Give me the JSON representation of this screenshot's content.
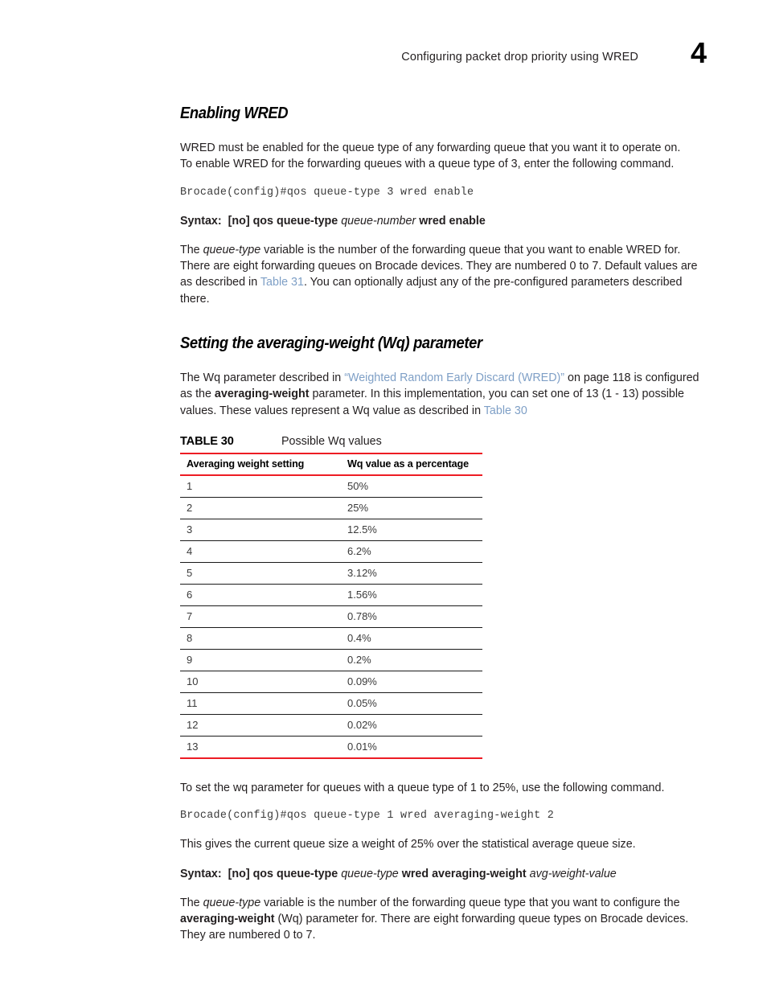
{
  "header": {
    "title": "Configuring packet drop priority using WRED",
    "chapter_number": "4"
  },
  "sections": [
    {
      "heading": "Enabling WRED",
      "paragraph_1_line_1": "WRED must be enabled for the queue type of any forwarding queue that you want it to operate on.",
      "paragraph_1_line_2": "To enable WRED for the forwarding queues with a queue type of 3, enter the following command.",
      "command": "Brocade(config)#qos queue-type 3 wred enable",
      "syntax": {
        "label": "Syntax:",
        "part_1": "[no] qos queue-type",
        "part_2": "queue-number",
        "part_3": "wred enable"
      },
      "paragraph_2": {
        "t1": "The ",
        "var1": "queue-type",
        "t2": " variable is the number of the forwarding queue that you want to enable WRED for. There are eight forwarding queues on Brocade devices. They are numbered 0 to 7. Default values are as described in ",
        "xref1": "Table 31",
        "t3": ". You can optionally adjust any of the pre-configured parameters described there."
      }
    },
    {
      "heading": "Setting the averaging-weight (Wq) parameter",
      "paragraph_1": {
        "t1": "The Wq parameter described in ",
        "xref1": "“Weighted Random Early Discard (WRED)”",
        "t2": " on page 118 is configured as the ",
        "kw1": "averaging-weight",
        "t3": " parameter. In this implementation, you can set one of 13 (1 - 13) possible values. These values represent a Wq value as described in ",
        "xref2": "Table 30"
      }
    }
  ],
  "table": {
    "number": "TABLE 30",
    "title": "Possible Wq values",
    "columns": [
      "Averaging weight setting",
      "Wq value as a percentage"
    ],
    "rows": [
      [
        "1",
        "50%"
      ],
      [
        "2",
        "25%"
      ],
      [
        "3",
        "12.5%"
      ],
      [
        "4",
        "6.2%"
      ],
      [
        "5",
        "3.12%"
      ],
      [
        "6",
        "1.56%"
      ],
      [
        "7",
        "0.78%"
      ],
      [
        "8",
        "0.4%"
      ],
      [
        "9",
        "0.2%"
      ],
      [
        "10",
        "0.09%"
      ],
      [
        "11",
        "0.05%"
      ],
      [
        "12",
        "0.02%"
      ],
      [
        "13",
        "0.01%"
      ]
    ]
  },
  "after_table": {
    "paragraph_1": "To set the wq parameter for queues with a queue type of 1 to 25%, use the following command.",
    "command": "Brocade(config)#qos queue-type 1 wred averaging-weight 2",
    "paragraph_2": "This gives the current queue size a weight of 25% over the statistical average queue size.",
    "syntax": {
      "label": "Syntax:",
      "part_1": "[no] qos queue-type",
      "part_2": "queue-type",
      "part_3": "wred averaging-weight",
      "part_4": "avg-weight-value"
    },
    "paragraph_3": {
      "t1": "The ",
      "var1": "queue-type",
      "t2": " variable is the number of the forwarding queue type that you want to configure the ",
      "kw1": "averaging-weight",
      "t3": " (Wq) parameter for. There are eight forwarding queue types on Brocade devices. They are numbered 0 to 7."
    }
  },
  "colors": {
    "rule_red": "#ed1c24",
    "xref_blue": "#7e9fc6",
    "body_text": "#231f20"
  }
}
